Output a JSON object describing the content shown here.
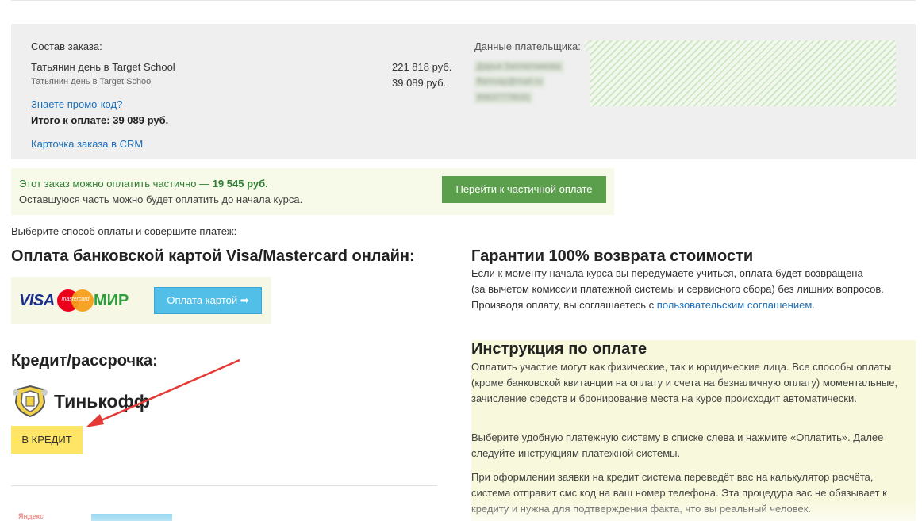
{
  "order": {
    "title": "Состав заказа:",
    "item_name": "Татьянин день в Target School",
    "item_subtitle": "Татьянин день в Target School",
    "old_price": "221 818 руб.",
    "new_price": "39 089 руб.",
    "promo_link": "Знаете промо-код?",
    "total": "Итого к оплате: 39 089 руб.",
    "crm_link": "Карточка заказа в CRM"
  },
  "payer": {
    "title": "Данные плательщика:",
    "name": "Дарья Заплатникова",
    "email": "ffamvay@mail.ru",
    "phone": "89637778031"
  },
  "partial": {
    "line1_prefix": "Этот заказ можно оплатить частично — ",
    "amount": "19 545 руб.",
    "line2": "Оставшуюся часть можно будет оплатить до начала курса.",
    "button": "Перейти к частичной оплате"
  },
  "choose_text": "Выберите способ оплаты и совершите платеж:",
  "card": {
    "heading": "Оплата банковской картой Visa/Mastercard онлайн:",
    "visa": "VISA",
    "mastercard": "mastercard",
    "mir": "МИР",
    "button": "Оплата картой ➡"
  },
  "credit": {
    "heading": "Кредит/рассрочка:",
    "provider": "Тинькофф",
    "button": "В КРЕДИТ"
  },
  "yandex": {
    "label": "Яндекс"
  },
  "guarantee": {
    "heading": "Гарантии 100% возврата стоимости",
    "text_line1": "Если к моменту начала курса вы передумаете учиться, оплата будет возвращена",
    "text_line2": "(за вычетом комиссии платежной системы и сервисного сбора) без лишних вопросов.",
    "text_line3_prefix": "Производя оплату, вы соглашаетесь с ",
    "agreement_link": "пользовательским соглашением",
    "text_line3_suffix": "."
  },
  "instructions": {
    "heading": "Инструкция по оплате",
    "p1": "Оплатить участие могут как физические, так и юридические лица. Все способы оплаты (кроме банковской квитанции на оплату и счета на безналичную оплату) моментальные, зачисление средств и бронирование места на курсе происходит автоматически.",
    "p2": "Выберите удобную платежную систему в списке слева и нажмите «Оплатить». Далее следуйте инструкциям платежной системы.",
    "p3": "При оформлении заявки на кредит система переведёт вас на калькулятор расчёта, система отправит смс код на ваш номер телефона. Эта процедура вас не обязывает к кредиту и нужна для подтверждения факта, что вы реальный человек."
  },
  "colors": {
    "link": "#1b6fb8",
    "green_button": "#5b9e4c",
    "blue_button": "#52bfe8",
    "yellow_button": "#ffe566",
    "arrow": "#e53935"
  }
}
